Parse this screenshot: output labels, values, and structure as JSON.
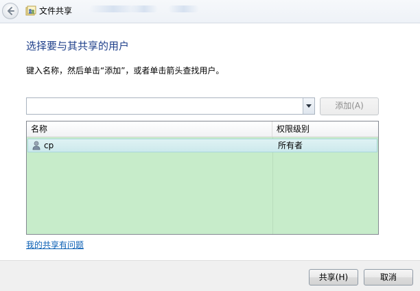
{
  "window": {
    "title": "文件共享",
    "icon": "file-share-icon"
  },
  "main": {
    "heading": "选择要与其共享的用户",
    "instruction": "键入名称，然后单击“添加”，或者单击箭头查找用户。",
    "user_input": {
      "value": "",
      "placeholder": ""
    },
    "add_button_label": "添加(A)",
    "list": {
      "columns": [
        "名称",
        "权限级别"
      ],
      "rows": [
        {
          "name": "cp",
          "permission": "所有者",
          "icon": "user-icon"
        }
      ]
    },
    "help_link": "我的共享有问题"
  },
  "footer": {
    "share_button_label": "共享(H)",
    "cancel_button_label": "取消"
  },
  "colors": {
    "heading": "#1e3f8a",
    "list_background": "#c7ecca",
    "selected_row": "#cce9ec",
    "link": "#0a5fb4"
  }
}
